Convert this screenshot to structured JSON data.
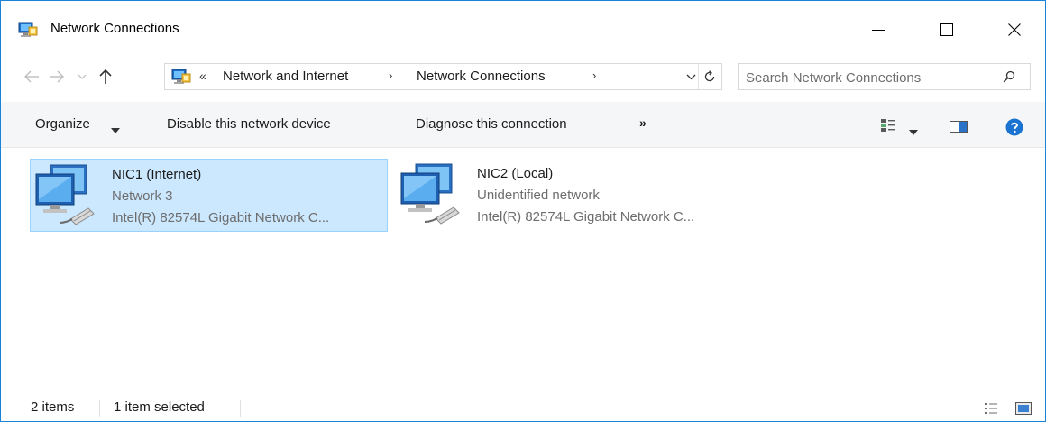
{
  "window": {
    "title": "Network Connections",
    "icon": "network-connections-icon",
    "controls": {
      "minimize": "minimize-icon",
      "maximize": "maximize-icon",
      "close": "close-icon"
    }
  },
  "navigation": {
    "back": "arrow-left-icon",
    "forward": "arrow-right-icon",
    "recent": "chevron-down-icon",
    "up": "arrow-up-icon"
  },
  "address": {
    "overflow": "«",
    "crumbs": [
      "Network and Internet",
      "Network Connections"
    ],
    "separator": "›",
    "dropdown": "chevron-down-icon",
    "refresh": "refresh-icon"
  },
  "search": {
    "placeholder": "Search Network Connections",
    "value": "",
    "icon": "search-icon"
  },
  "commands": {
    "organize": "Organize",
    "disable": "Disable this network device",
    "diagnose": "Diagnose this connection",
    "more": "»",
    "view_icon": "change-view-icon",
    "preview_pane_icon": "preview-pane-icon",
    "help_icon": "help-icon"
  },
  "connections": [
    {
      "name": "NIC1 (Internet)",
      "network": "Network  3",
      "adapter": "Intel(R) 82574L Gigabit Network C...",
      "selected": true,
      "icon": "network-adapter-icon"
    },
    {
      "name": "NIC2 (Local)",
      "network": "Unidentified network",
      "adapter": "Intel(R) 82574L Gigabit Network C...",
      "selected": false,
      "icon": "network-adapter-icon"
    }
  ],
  "status": {
    "item_count": "2 items",
    "selection": "1 item selected",
    "details_view_icon": "details-view-icon",
    "large_icons_view_icon": "large-icons-view-icon"
  },
  "colors": {
    "window_border": "#1883d7",
    "selection_fill": "#cce8ff",
    "selection_border": "#99d1ff",
    "secondary_text": "#6d6d6d",
    "help_blue": "#1a73d0"
  }
}
